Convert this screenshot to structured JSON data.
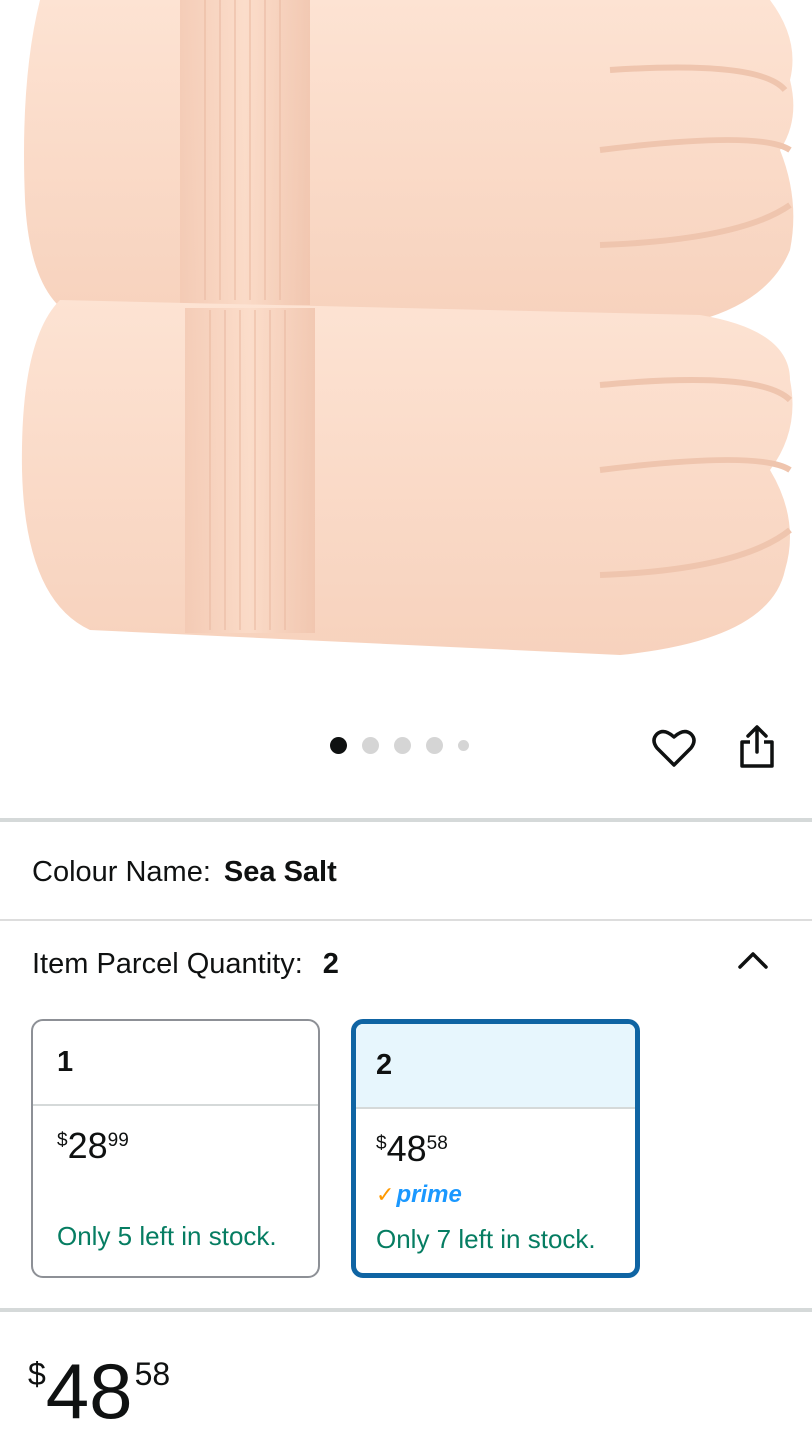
{
  "gallery": {
    "image_name": "towel-product-image",
    "dot_count": 5,
    "active_index": 0
  },
  "actions": {
    "wishlist_icon": "heart-icon",
    "share_icon": "share-icon"
  },
  "variation": {
    "colour_label": "Colour Name:",
    "colour_value": "Sea Salt",
    "quantity_label": "Item Parcel Quantity:",
    "quantity_value": "2",
    "toggle_icon": "chevron-up-icon"
  },
  "options": [
    {
      "label": "1",
      "price_symbol": "$",
      "price_whole": "28",
      "price_cents": "99",
      "prime": false,
      "stock": "Only 5 left in stock.",
      "selected": false
    },
    {
      "label": "2",
      "price_symbol": "$",
      "price_whole": "48",
      "price_cents": "58",
      "prime": true,
      "prime_label": "prime",
      "stock": "Only 7 left in stock.",
      "selected": true
    }
  ],
  "price": {
    "symbol": "$",
    "whole": "48",
    "cents": "58"
  },
  "colors": {
    "towel": "#fbdcc9",
    "selected_border": "#0f64a3",
    "selected_bg": "#e7f6fd",
    "stock_green": "#067d62",
    "prime_blue": "#1a98ff",
    "prime_check": "#ff9900"
  }
}
